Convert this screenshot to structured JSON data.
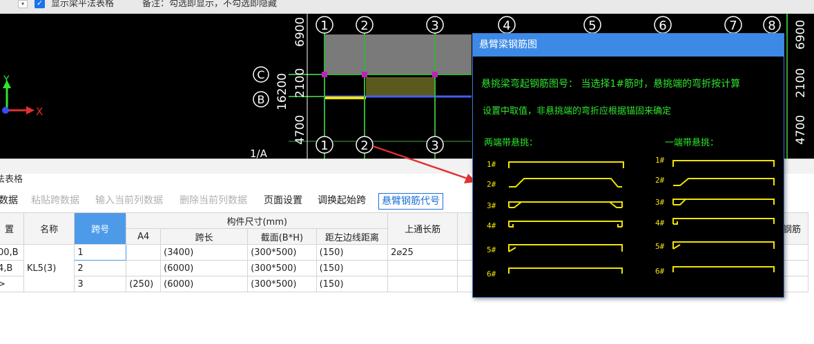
{
  "topbar": {
    "show_table_label": "显示梁平法表格",
    "remark": "备注：勾选即显示，不勾选即隐藏"
  },
  "cad": {
    "axis_numbers_top": [
      "1",
      "2",
      "3",
      "4",
      "5",
      "6",
      "7",
      "8"
    ],
    "axis_numbers_bottom": [
      "1",
      "2",
      "3"
    ],
    "row_letters": [
      "C",
      "B"
    ],
    "dims_left": [
      "6900",
      "2100",
      "16200",
      "4700"
    ],
    "dims_right": [
      "6900",
      "2100",
      "4700"
    ],
    "partial_label": "1/A",
    "axis_x": "X",
    "axis_y": "Y"
  },
  "panel": {
    "title": "法表格",
    "toolbar": [
      {
        "label": "数据",
        "state": "enabled"
      },
      {
        "label": "粘贴跨数据",
        "state": "disabled"
      },
      {
        "label": "输入当前列数据",
        "state": "disabled"
      },
      {
        "label": "删除当前列数据",
        "state": "disabled"
      },
      {
        "label": "页面设置",
        "state": "enabled"
      },
      {
        "label": "调换起始跨",
        "state": "enabled"
      },
      {
        "label": "悬臂钢筋代号",
        "state": "active"
      }
    ],
    "table": {
      "group_header": "构件尺寸(mm)",
      "headers": {
        "position": "置",
        "name": "名称",
        "span_no": "跨号",
        "a4": "A4",
        "span_length": "跨长",
        "section": "截面(B*H)",
        "left_edge": "距左边线距离",
        "top_long_bar": "上通长筋",
        "right_partial": "钢筋"
      },
      "rows": [
        {
          "position": "00,B",
          "name": "",
          "span_no": "1",
          "a4": "",
          "span_length": "(3400)",
          "section": "(300*500)",
          "left_edge": "(150)",
          "top_long_bar": "2⌀25"
        },
        {
          "position": "4,B",
          "name": "KL5(3)",
          "span_no": "2",
          "a4": "",
          "span_length": "(6000)",
          "section": "(300*500)",
          "left_edge": "(150)",
          "top_long_bar": ""
        },
        {
          "position": ">",
          "name": "",
          "span_no": "3",
          "a4": "(250)",
          "span_length": "(6000)",
          "section": "(300*500)",
          "left_edge": "(150)",
          "top_long_bar": ""
        }
      ]
    }
  },
  "popup": {
    "title": "悬臂梁钢筋图",
    "line1": "悬挑梁弯起钢筋图号：  当选择1#筋时，悬挑端的弯折按计算",
    "line2": "设置中取值，非悬挑端的弯折应根据锚固来确定",
    "both_label": "两端带悬挑：",
    "one_label": "一端带悬挑：",
    "both_items": [
      "1#",
      "2#",
      "3#",
      "4#",
      "5#",
      "6#"
    ],
    "one_items": [
      "1#",
      "2#",
      "3#",
      "4#",
      "5#",
      "6#"
    ]
  },
  "colors": {
    "accent": "#3d8ae6",
    "cad_bg": "#000000",
    "green_text": "#2fe62f",
    "rebar_yellow": "#f2e500",
    "arrow_red": "#e03030"
  }
}
